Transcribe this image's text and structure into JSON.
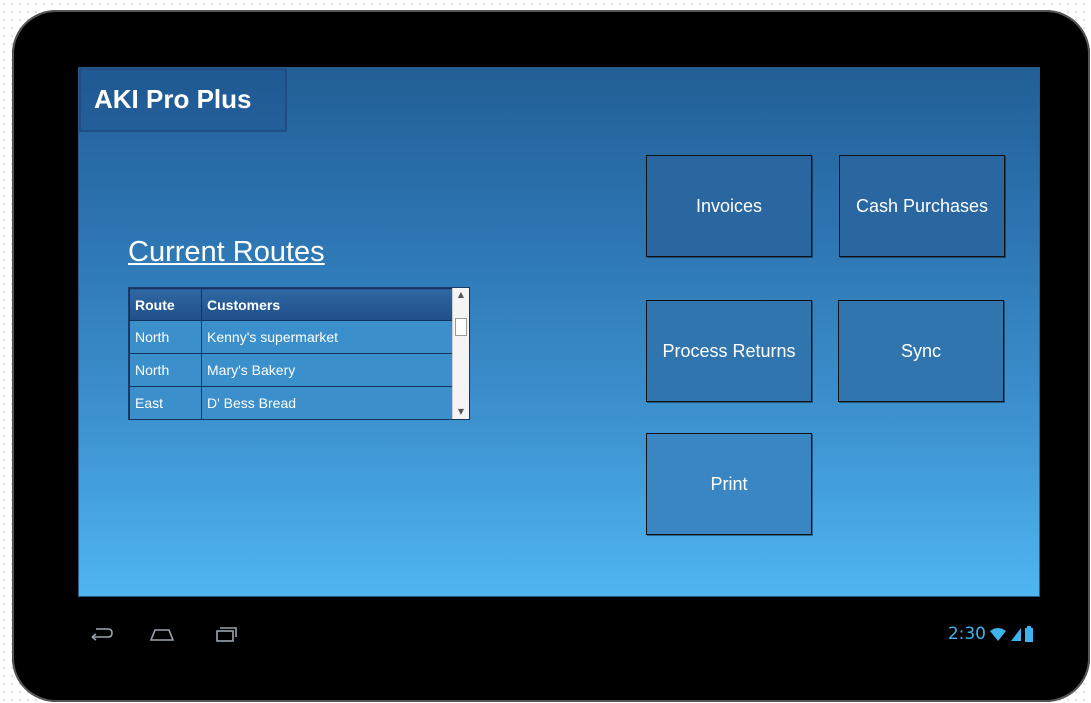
{
  "app": {
    "title": "AKI Pro Plus"
  },
  "routes_section": {
    "title": "Current Routes",
    "columns": [
      "Route",
      "Customers"
    ],
    "rows": [
      {
        "route": "North",
        "customer": "Kenny's supermarket"
      },
      {
        "route": "North",
        "customer": "Mary's Bakery"
      },
      {
        "route": "East",
        "customer": "D' Bess Bread"
      }
    ]
  },
  "actions": {
    "invoices": "Invoices",
    "cash_purchases": "Cash Purchases",
    "process_returns": "Process Returns",
    "sync": "Sync",
    "print": "Print"
  },
  "system_bar": {
    "time": "2:30",
    "icons": [
      "back-icon",
      "home-icon",
      "recent-apps-icon",
      "wifi-icon",
      "signal-icon",
      "battery-icon"
    ]
  },
  "colors": {
    "screen_top": "#225f96",
    "screen_bottom": "#4fb6f2",
    "status_accent": "#3fb3ef"
  }
}
